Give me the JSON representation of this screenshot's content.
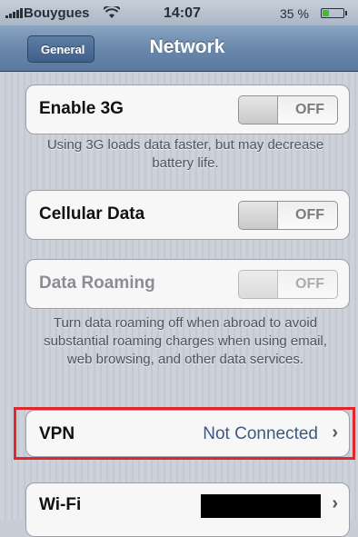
{
  "status_bar": {
    "carrier": "Bouygues",
    "time": "14:07",
    "battery": "35 %",
    "battery_level": 0.35,
    "signal_icon": "signal-bars-icon",
    "wifi_icon": "wifi-icon"
  },
  "nav": {
    "back_label": "General",
    "title": "Network"
  },
  "settings": {
    "enable_3g": {
      "label": "Enable 3G",
      "toggle": "OFF"
    },
    "enable_3g_note": "Using 3G loads data faster, but may decrease battery life.",
    "cellular_data": {
      "label": "Cellular Data",
      "toggle": "OFF"
    },
    "data_roaming": {
      "label": "Data Roaming",
      "toggle": "OFF"
    },
    "roaming_note": "Turn data roaming off when abroad to avoid substantial roaming charges when using email, web browsing, and other data services.",
    "vpn": {
      "label": "VPN",
      "value": "Not Connected"
    },
    "wifi": {
      "label": "Wi-Fi"
    }
  },
  "colors": {
    "highlight": "#e0272f",
    "nav_bar": "#6a88ac"
  }
}
